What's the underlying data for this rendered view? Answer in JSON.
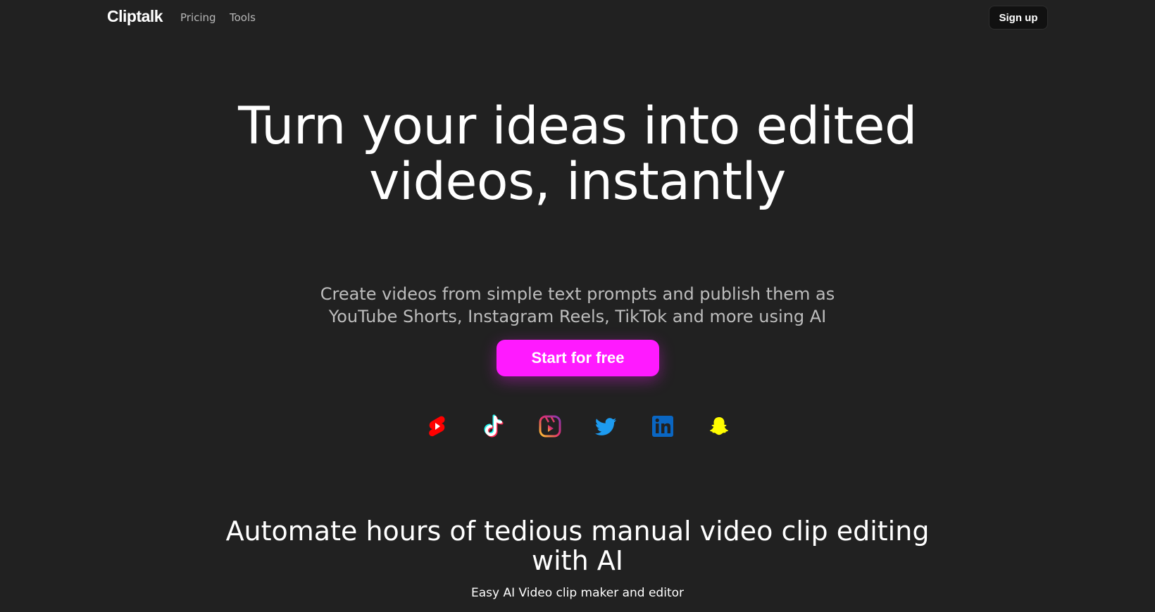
{
  "nav": {
    "brand": "Cliptalk",
    "links": [
      "Pricing",
      "Tools"
    ],
    "signup_label": "Sign up"
  },
  "hero": {
    "title": "Turn your ideas into edited videos, instantly",
    "subtitle": "Create videos from simple text prompts and publish them as YouTube Shorts, Instagram Reels, TikTok and more using AI",
    "cta_label": "Start for free"
  },
  "platforms": [
    {
      "name": "youtube-shorts-icon",
      "color": "#ff0000"
    },
    {
      "name": "tiktok-icon",
      "color": "#ffffff"
    },
    {
      "name": "instagram-reels-icon",
      "color": "#c13584"
    },
    {
      "name": "twitter-icon",
      "color": "#1d9bf0"
    },
    {
      "name": "linkedin-icon",
      "color": "#0a66c2"
    },
    {
      "name": "snapchat-icon",
      "color": "#fffc00"
    }
  ],
  "section": {
    "title": "Automate hours of tedious manual video clip editing with AI",
    "subtitle": "Easy AI Video clip maker and editor"
  },
  "colors": {
    "background": "#212121",
    "accent": "#ff1aff",
    "muted_text": "#bdbdbd"
  }
}
